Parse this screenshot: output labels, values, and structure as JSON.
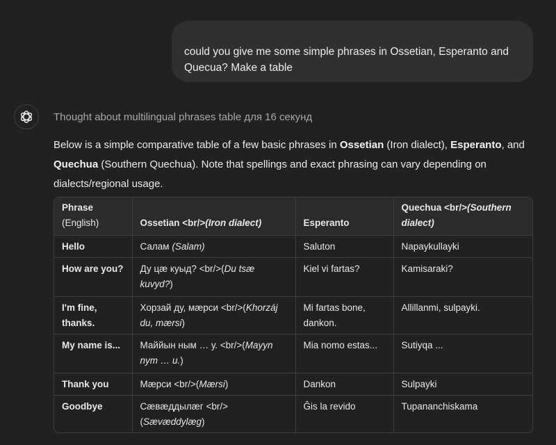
{
  "user_message": "could you give me some simple phrases in Ossetian, Esperanto and Quecua? Make a table",
  "thought_label": "Thought about multilingual phrases table для 16 секунд",
  "intro": {
    "p1": "Below is a simple comparative table of a few basic phrases in ",
    "ossetian": "Ossetian",
    "p2": " (Iron dialect), ",
    "esperanto": "Esperanto",
    "p3": ", and ",
    "quechua": "Quechua",
    "p4": " (Southern Quechua). Note that spellings and exact phrasing can vary depending on dialects/regional usage."
  },
  "table": {
    "headers": [
      {
        "main": "Phrase",
        "sub": "(English)"
      },
      {
        "main": "Ossetian <br/>",
        "italic": "(Iron dialect)"
      },
      {
        "main": "Esperanto"
      },
      {
        "main": "Quechua <br/>",
        "italic": "(Southern dialect)"
      }
    ],
    "rows": [
      {
        "phrase": "Hello",
        "oss": "Салам ",
        "oss_i": "(Salam)",
        "esp": "Saluton",
        "que": "Napaykullayki"
      },
      {
        "phrase": "How are you?",
        "oss": "Ду цæ куыд? <br/>(",
        "oss_i": "Du tsæ kuvyd?",
        "oss_end": ")",
        "esp": "Kiel vi fartas?",
        "que": "Kamisaraki?"
      },
      {
        "phrase": "I'm fine, thanks.",
        "oss": "Хорзай ду, мæрси <br/>(",
        "oss_i": "Khorzáj du, mærsi",
        "oss_end": ")",
        "esp": "Mi fartas bone, dankon.",
        "que": "Allillanmi, sulpayki."
      },
      {
        "phrase": "My name is...",
        "oss": "Маййын ным … у. <br/>(",
        "oss_i": "Mayyn nym … u.",
        "oss_end": ")",
        "esp": "Mia nomo estas...",
        "que": "Sutiyqa ..."
      },
      {
        "phrase": "Thank you",
        "oss": "Мæрси <br/>(",
        "oss_i": "Mærsi",
        "oss_end": ")",
        "esp": "Dankon",
        "que": "Sulpayki"
      },
      {
        "phrase": "Goodbye",
        "oss": "Сæвæддылæг <br/> (",
        "oss_i": "Sævæddylæg",
        "oss_end": ")",
        "esp": "Ĝis la revido",
        "que": "Tupananchiskama"
      }
    ]
  },
  "icons": {
    "assistant": "openai-logo-icon"
  },
  "colors": {
    "background": "#212121",
    "user_bubble": "#303030",
    "table_header": "#2b2b2b",
    "border": "#3d3d3d"
  }
}
